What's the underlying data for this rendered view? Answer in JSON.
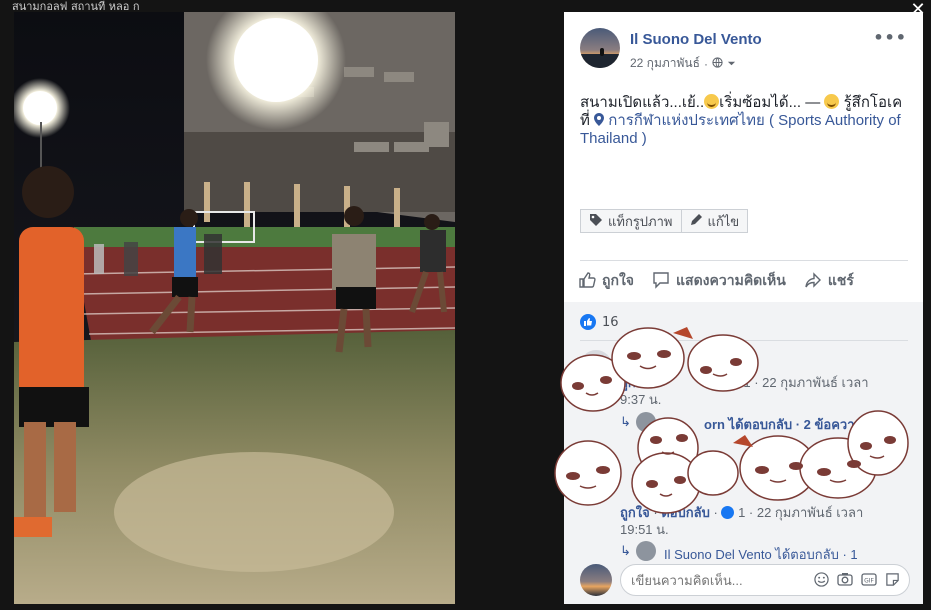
{
  "top_strip": {
    "text": "สนามกอลฟ สถานที่ หลอ ก"
  },
  "close": {
    "glyph": "✕"
  },
  "post": {
    "author": "Il Suono Del Vento",
    "date": "22 กุมภาพันธ์",
    "sep": "·",
    "privacy_icon": "globe-icon",
    "text_1": "สนามเปิดแล้ว...เย้..",
    "text_2": "เริ่มซ้อมได้... — ",
    "text_3": "รู้สึกโอเคที่ ",
    "location": "การกีฬาแห่งประเทศไทย ( Sports Authority of Thailand )",
    "more": "•••"
  },
  "tag_bar": {
    "tag_label": "แท็กรูปภาพ",
    "edit_label": "แก้ไข"
  },
  "actions": {
    "like": "ถูกใจ",
    "comment": "แสดงความคิดเห็น",
    "share": "แชร์"
  },
  "reactions": {
    "count": "16"
  },
  "comment1": {
    "name_partial": "ถูกใจ",
    "like_count": "1",
    "time": "22 กุมภาพันธ์ เวลา",
    "time2": "9:37 น.",
    "reply_summary": "orn ได้ตอบกลับ · 2 ข้อความตอบ"
  },
  "comment2": {
    "like": "ถูกใจ",
    "reply": "ตอบกลับ",
    "like_count": "1",
    "time": "22 กุมภาพันธ์ เวลา",
    "time2": "19:51 น.",
    "reply_summary": "Il Suono Del Vento ได้ตอบกลับ · 1"
  },
  "composer": {
    "placeholder": "เขียนความคิดเห็น..."
  },
  "colors": {
    "link": "#385898",
    "like_blue": "#1877f2",
    "panel_bg": "#ffffff",
    "comment_bg": "#f2f3f5"
  }
}
